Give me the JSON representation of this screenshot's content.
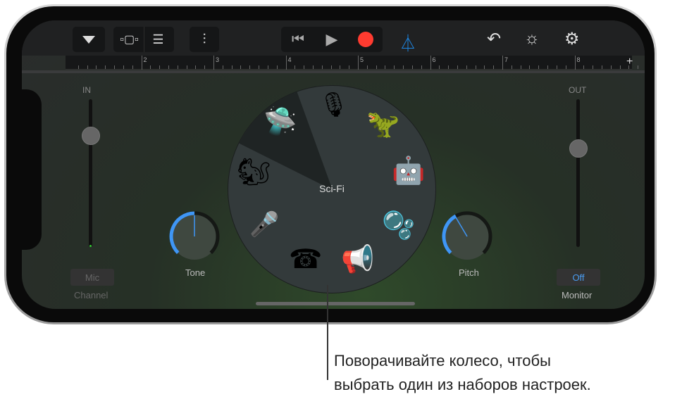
{
  "toolbar": {
    "icons": [
      "triangle-down-icon",
      "tracks-view-icon",
      "list-view-icon",
      "mixer-icon",
      "rewind-icon",
      "play-icon",
      "record-icon",
      "metronome-icon",
      "undo-icon",
      "master-volume-icon",
      "settings-icon"
    ],
    "record_color": "#ff3b30",
    "accent": "#1e88e5"
  },
  "ruler": {
    "marks": [
      "2",
      "3",
      "4",
      "5",
      "6",
      "7",
      "8"
    ],
    "add": "+"
  },
  "input": {
    "label": "IN",
    "button": "Mic",
    "caption": "Channel"
  },
  "output": {
    "label": "OUT",
    "button": "Off",
    "caption": "Monitor"
  },
  "knobs": [
    {
      "label": "Tone",
      "value_fraction": 0.5
    },
    {
      "label": "Pitch",
      "value_fraction": 0.4
    }
  ],
  "wheel": {
    "selected": "Sci-Fi",
    "presets": [
      "ufo",
      "microphone",
      "monster",
      "robot",
      "bubbles",
      "megaphone",
      "telephone",
      "mic-handheld",
      "squirrel"
    ]
  },
  "callout": {
    "line1": "Поворачивайте колесо, чтобы",
    "line2": "выбрать один из наборов настроек."
  }
}
